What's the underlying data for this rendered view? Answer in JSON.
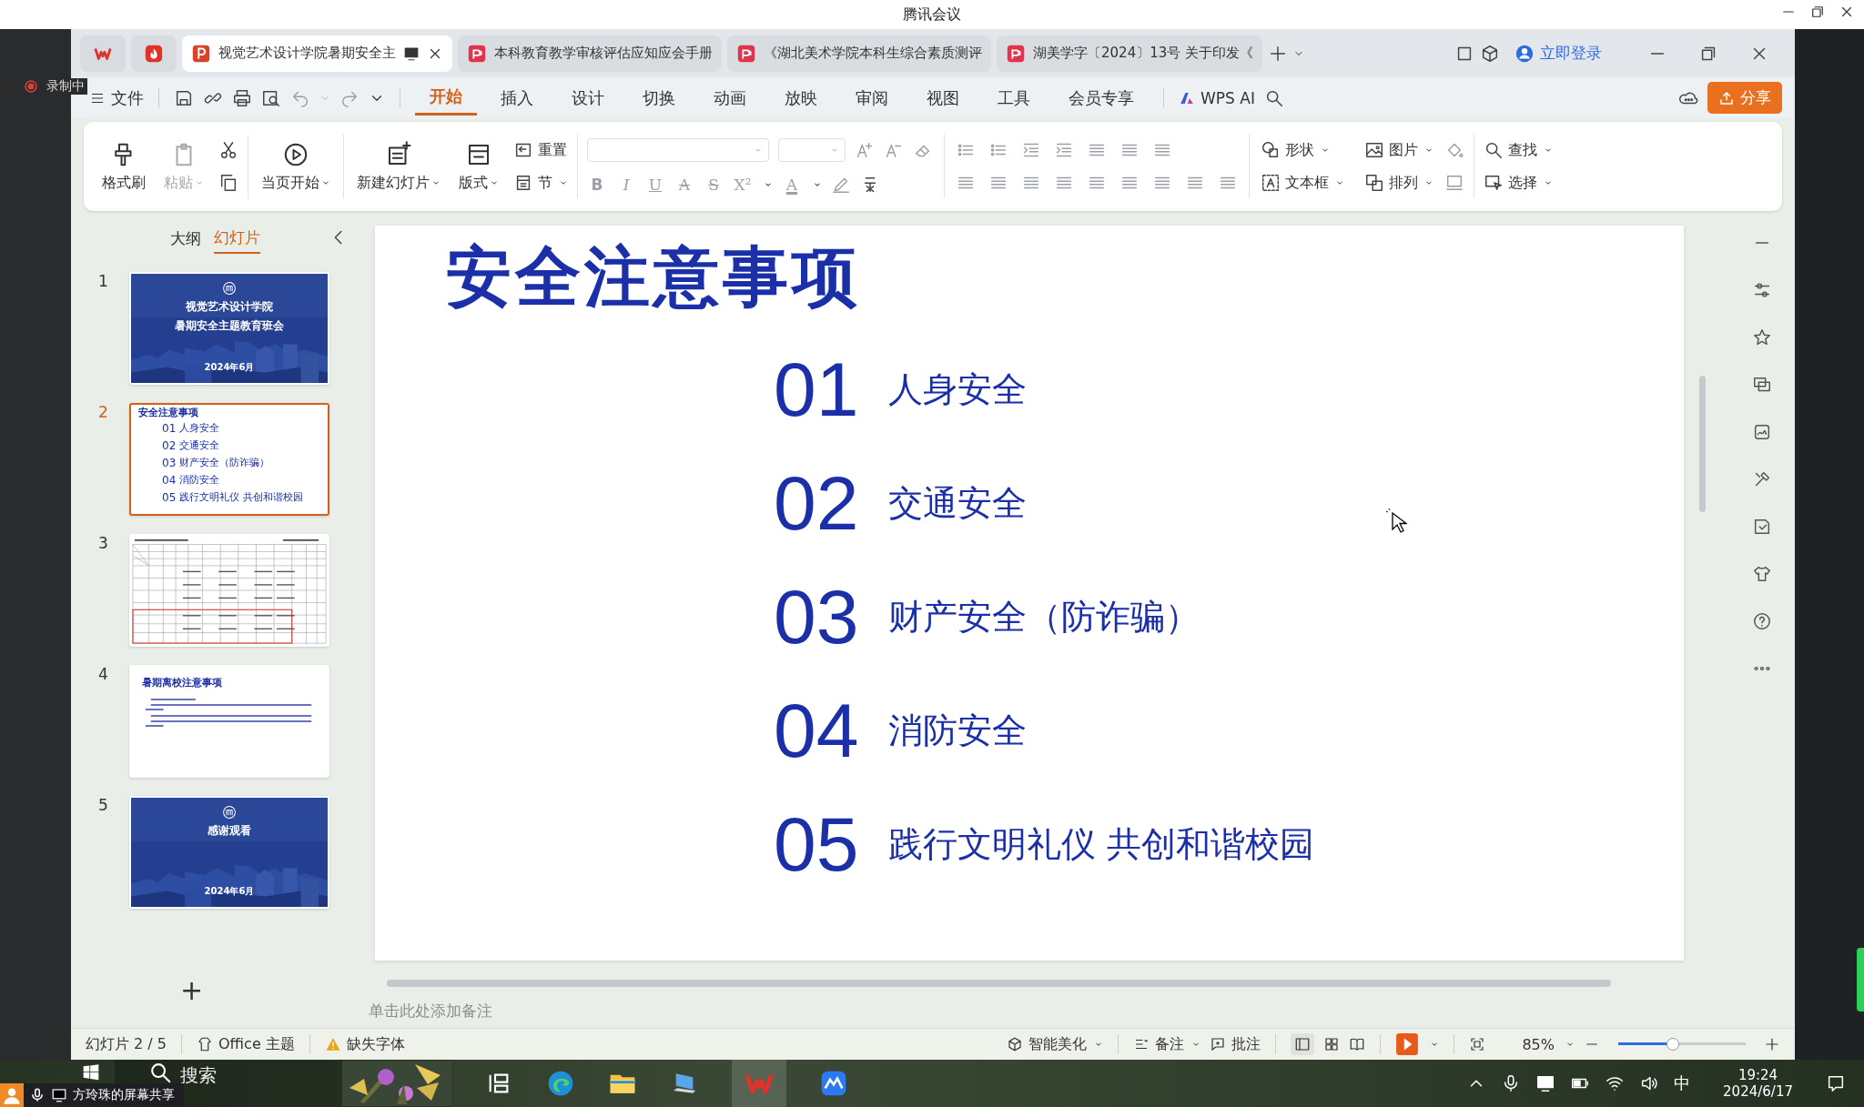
{
  "meeting_window": {
    "title": "腾讯会议"
  },
  "recording": {
    "label": "录制中"
  },
  "tabs": [
    {
      "title": "视觉艺术设计学院暑期安全主",
      "selected": true
    },
    {
      "title": "本科教育教学审核评估应知应会手册",
      "selected": false
    },
    {
      "title": "《湖北美术学院本科生综合素质测评",
      "selected": false
    },
    {
      "title": "湖美学字〔2024〕13号 关于印发《",
      "selected": false
    }
  ],
  "login": "立即登录",
  "menu": {
    "file": "文件",
    "items": [
      {
        "label": "开始",
        "selected": true
      },
      {
        "label": "插入",
        "selected": false
      },
      {
        "label": "设计",
        "selected": false
      },
      {
        "label": "切换",
        "selected": false
      },
      {
        "label": "动画",
        "selected": false
      },
      {
        "label": "放映",
        "selected": false
      },
      {
        "label": "审阅",
        "selected": false
      },
      {
        "label": "视图",
        "selected": false
      },
      {
        "label": "工具",
        "selected": false
      },
      {
        "label": "会员专享",
        "selected": false
      }
    ],
    "ai": "WPS AI",
    "share": "分享"
  },
  "ribbon": {
    "groups": [
      {
        "items": [
          {
            "label": "格式刷",
            "kind": "large",
            "dropdown": false,
            "disabled": false
          },
          {
            "label": "粘贴",
            "kind": "large",
            "dropdown": true,
            "disabled": true
          }
        ]
      },
      {
        "items": [
          {
            "label": "当页开始",
            "kind": "large",
            "dropdown": true,
            "disabled": false
          }
        ]
      },
      {
        "items": [
          {
            "label": "新建幻灯片",
            "kind": "large",
            "dropdown": true,
            "disabled": false
          },
          {
            "label": "版式",
            "kind": "large",
            "dropdown": true,
            "disabled": false
          },
          {
            "label": "重置",
            "kind": "small",
            "dropdown": false,
            "disabled": false
          },
          {
            "label": "节",
            "kind": "small",
            "dropdown": true,
            "disabled": false
          }
        ]
      },
      {
        "items": [
          {
            "label": "形状",
            "kind": "small",
            "dropdown": true,
            "disabled": false
          },
          {
            "label": "文本框",
            "kind": "small",
            "dropdown": true,
            "disabled": false
          },
          {
            "label": "图片",
            "kind": "small",
            "dropdown": true,
            "disabled": false
          },
          {
            "label": "排列",
            "kind": "small",
            "dropdown": true,
            "disabled": false
          }
        ]
      },
      {
        "items": [
          {
            "label": "查找",
            "kind": "small",
            "dropdown": true,
            "disabled": false
          },
          {
            "label": "选择",
            "kind": "small",
            "dropdown": true,
            "disabled": false
          }
        ]
      }
    ],
    "font_buttons": [
      "B",
      "I",
      "U",
      "A",
      "S",
      "X²",
      "A"
    ]
  },
  "panel": {
    "tabs": [
      {
        "label": "大纲",
        "selected": false
      },
      {
        "label": "幻灯片",
        "selected": true
      }
    ]
  },
  "slides": [
    {
      "number": "1",
      "kind": "cover",
      "selected": false,
      "lines": [
        "视觉艺术设计学院",
        "暑期安全主题教育班会"
      ],
      "date": "2024年6月"
    },
    {
      "number": "2",
      "kind": "agenda",
      "selected": true,
      "title": "安全注意事项",
      "items": [
        {
          "number": "01",
          "text": "人身安全"
        },
        {
          "number": "02",
          "text": "交通安全"
        },
        {
          "number": "03",
          "text": "财产安全（防诈骗）"
        },
        {
          "number": "04",
          "text": "消防安全"
        },
        {
          "number": "05",
          "text": "践行文明礼仪 共创和谐校园"
        }
      ]
    },
    {
      "number": "3",
      "kind": "table",
      "selected": false
    },
    {
      "number": "4",
      "kind": "notice",
      "selected": false,
      "title": "暑期离校注意事项"
    },
    {
      "number": "5",
      "kind": "cover",
      "selected": false,
      "lines": [
        "感谢观看"
      ],
      "date": "2024年6月"
    }
  ],
  "add_slide": "+",
  "slide": {
    "title": "安全注意事项",
    "items": [
      {
        "number": "01",
        "text": "人身安全"
      },
      {
        "number": "02",
        "text": "交通安全"
      },
      {
        "number": "03",
        "text": "财产安全（防诈骗）"
      },
      {
        "number": "04",
        "text": "消防安全"
      },
      {
        "number": "05",
        "text": "践行文明礼仪 共创和谐校园"
      }
    ]
  },
  "notes": {
    "placeholder": "单击此处添加备注"
  },
  "status_bar": {
    "slide": "幻灯片 2 / 5",
    "theme": "Office 主题",
    "font_warning": "缺失字体",
    "beautify": "智能美化",
    "notes": "备注",
    "comments": "批注",
    "zoom": "85%",
    "zoom_slider": {
      "level": 0.42
    }
  },
  "taskbar": {
    "search": "搜索",
    "ime": "中",
    "time": "19:24",
    "date": "2024/6/17"
  },
  "screen_share": {
    "label": "方玲珠的屏幕共享"
  }
}
